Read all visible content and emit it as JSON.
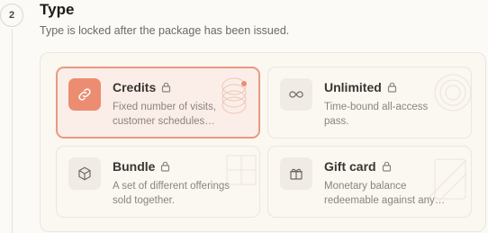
{
  "step": {
    "number": "2"
  },
  "section": {
    "title": "Type",
    "subtitle": "Type is locked after the package has been issued."
  },
  "options": [
    {
      "name": "Credits",
      "desc_line1": "Fixed number of visits,",
      "desc_line2": "customer schedules…",
      "icon": "link-icon",
      "selected": true
    },
    {
      "name": "Unlimited",
      "desc_line1": "Time-bound all-access",
      "desc_line2": "pass.",
      "icon": "infinity-icon",
      "selected": false
    },
    {
      "name": "Bundle",
      "desc_line1": "A set of different offerings",
      "desc_line2": "sold together.",
      "icon": "box-icon",
      "selected": false
    },
    {
      "name": "Gift card",
      "desc_line1": "Monetary balance",
      "desc_line2": "redeemable against any…",
      "icon": "gift-icon",
      "selected": false
    }
  ],
  "colors": {
    "accent": "#ec8d72",
    "accent_border": "#e89a82",
    "selected_bg": "#fbeee8"
  }
}
